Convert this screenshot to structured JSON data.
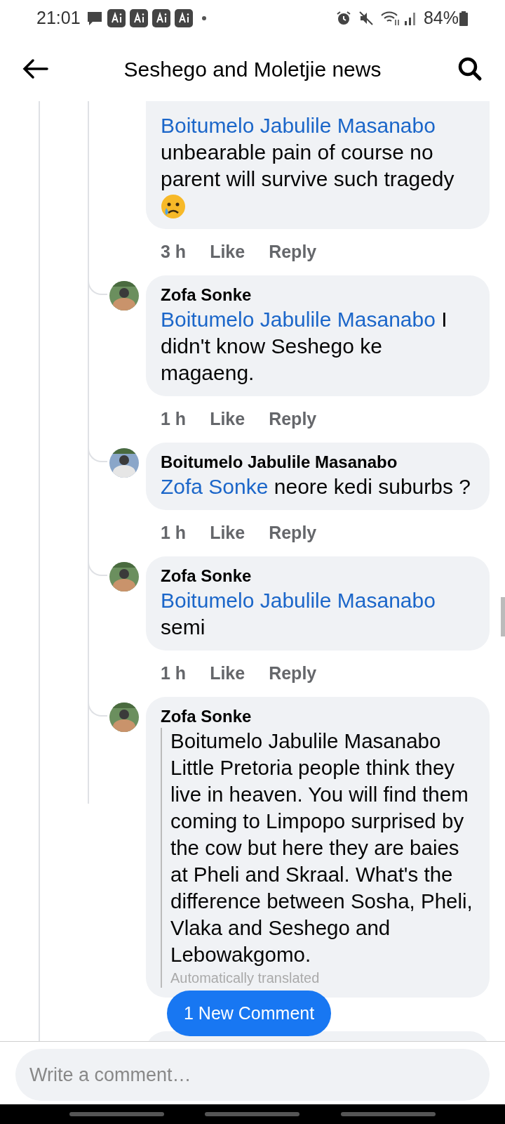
{
  "status_bar": {
    "time": "21:01",
    "battery": "84%"
  },
  "header": {
    "title": "Seshego and Moletjie news"
  },
  "comments": [
    {
      "kind": "mention",
      "mention": "Boitumelo Jabulile Masanabo",
      "text": "unbearable pain of course no parent will survive such tragedy",
      "emoji": true,
      "time": "3 h",
      "like": "Like",
      "reply": "Reply"
    },
    {
      "kind": "mention",
      "author": "Zofa Sonke",
      "mention": "Boitumelo Jabulile Masanabo",
      "text": "I didn't know Seshego ke magaeng.",
      "time": "1 h",
      "like": "Like",
      "reply": "Reply"
    },
    {
      "kind": "mention",
      "author": "Boitumelo Jabulile Masanabo",
      "mention": "Zofa Sonke",
      "text": "neore kedi suburbs ?",
      "time": "1 h",
      "like": "Like",
      "reply": "Reply"
    },
    {
      "kind": "mention",
      "author": "Zofa Sonke",
      "mention": "Boitumelo Jabulile Masanabo",
      "text": "semi",
      "time": "1 h",
      "like": "Like",
      "reply": "Reply"
    },
    {
      "kind": "translated",
      "author": "Zofa Sonke",
      "text": "Boitumelo Jabulile Masanabo Little Pretoria people think they live in heaven. You will find them coming to Limpopo surprised by the cow but here they are baies at Pheli and Skraal. What's the difference between Sosha, Pheli, Vlaka and Seshego and Lebowakgomo.",
      "note": "Automatically translated"
    }
  ],
  "new_comments": {
    "label": "1 New Comment"
  },
  "composer": {
    "placeholder": "Write a comment…"
  }
}
